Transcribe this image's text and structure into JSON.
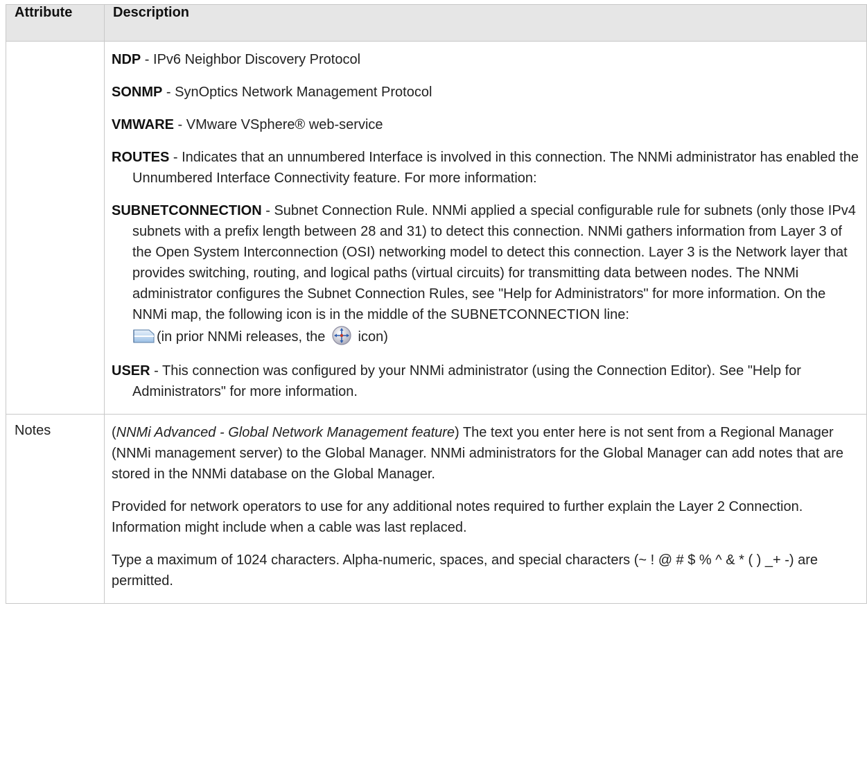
{
  "table": {
    "headers": {
      "attribute": "Attribute",
      "description": "Description"
    },
    "discovery_rows": [
      {
        "term": "NDP",
        "text": " - IPv6 Neighbor Discovery Protocol"
      },
      {
        "term": "SONMP",
        "text": " - SynOptics Network Management Protocol"
      },
      {
        "term": "VMWARE",
        "text": " - VMware VSphere® web-service"
      },
      {
        "term": "ROUTES",
        "text": " - Indicates that an unnumbered Interface is involved in this connection. The NNMi administrator has enabled the Unnumbered Interface Connectivity feature. For more information:"
      },
      {
        "term": "SUBNETCONNECTION",
        "text": " - Subnet Connection Rule. NNMi applied a special configurable rule for subnets (only those IPv4 subnets with a prefix length between 28 and 31) to detect this connection. NNMi gathers information from Layer 3 of the Open System Interconnection (OSI) networking model to detect this connection. Layer 3 is the Network layer that provides switching, routing, and logical paths (virtual circuits) for transmitting data between nodes. The NNMi administrator configures the Subnet Connection Rules, see \"Help for Administrators\" for more information. On the NNMi map, the following icon is in the middle of the SUBNETCONNECTION line:"
      },
      {
        "term": "USER",
        "text": " - This connection was configured by your NNMi administrator (using the Connection Editor). See \"Help for Administrators\" for more information."
      }
    ],
    "icon_line": {
      "text_before": "(in prior NNMi releases, the ",
      "text_after": " icon)"
    },
    "notes": {
      "attribute": "Notes",
      "para1_open": "(",
      "para1_italic": "NNMi Advanced - Global Network Management feature",
      "para1_rest": ") The text you enter here is not sent from a Regional Manager (NNMi management server) to the Global Manager. NNMi administrators for the Global Manager can add notes that are stored in the NNMi database on the Global Manager.",
      "para2": "Provided for network operators to use for any additional notes required to further explain the Layer 2 Connection. Information might include when a cable was last replaced.",
      "para3": "Type a maximum of 1024 characters. Alpha-numeric, spaces, and special characters (~ ! @ # $ % ^ & * ( ) _+ -) are permitted."
    },
    "icons": {
      "subnet_connection": "subnet-connection-icon",
      "hub": "connection-hub-icon"
    },
    "colors": {
      "header_bg": "#e6e6e6",
      "border": "#c8c8c8",
      "text": "#222222"
    }
  }
}
